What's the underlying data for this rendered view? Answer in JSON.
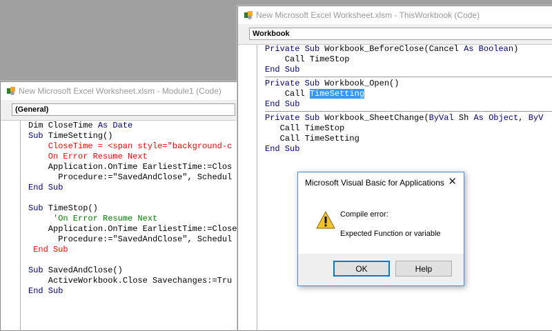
{
  "module_window": {
    "title": "New Microsoft Excel Worksheet.xlsm - Module1 (Code)",
    "object_combo": "(General)",
    "code": [
      {
        "segments": [
          {
            "t": "Dim CloseTime ",
            "c": ""
          },
          {
            "t": "As",
            "c": "kw"
          },
          {
            "t": " Date",
            "c": "kw"
          }
        ]
      },
      {
        "segments": [
          {
            "t": "Sub",
            "c": "kw"
          },
          {
            "t": " TimeSetting()",
            "c": ""
          }
        ]
      },
      {
        "segments": [
          {
            "t": "    CloseTime = <span style=\"background-c",
            "c": "err"
          }
        ]
      },
      {
        "segments": [
          {
            "t": "    On Error Resume Next",
            "c": "err"
          }
        ]
      },
      {
        "segments": [
          {
            "t": "    Application.OnTime EarliestTime:=Clos",
            "c": ""
          }
        ]
      },
      {
        "segments": [
          {
            "t": "      Procedure:=\"SavedAndClose\", Schedul",
            "c": ""
          }
        ]
      },
      {
        "segments": [
          {
            "t": "End Sub",
            "c": "kw"
          }
        ]
      },
      {
        "segments": [
          {
            "t": "",
            "c": ""
          }
        ]
      },
      {
        "segments": [
          {
            "t": "Sub",
            "c": "kw"
          },
          {
            "t": " TimeStop()",
            "c": ""
          }
        ]
      },
      {
        "segments": [
          {
            "t": "     'On Error Resume Next",
            "c": "cmt"
          }
        ]
      },
      {
        "segments": [
          {
            "t": "    Application.OnTime EarliestTime:=Close",
            "c": ""
          }
        ]
      },
      {
        "segments": [
          {
            "t": "      Procedure:=\"SavedAndClose\", Schedul",
            "c": ""
          }
        ]
      },
      {
        "segments": [
          {
            "t": " End Sub",
            "c": "err"
          }
        ]
      },
      {
        "segments": [
          {
            "t": "",
            "c": ""
          }
        ]
      },
      {
        "segments": [
          {
            "t": "Sub",
            "c": "kw"
          },
          {
            "t": " SavedAndClose()",
            "c": ""
          }
        ]
      },
      {
        "segments": [
          {
            "t": "    ActiveWorkbook.Close Savechanges:=Tru",
            "c": ""
          }
        ]
      },
      {
        "segments": [
          {
            "t": "End Sub",
            "c": "kw"
          }
        ]
      }
    ]
  },
  "workbook_window": {
    "title": "New Microsoft Excel Worksheet.xlsm - ThisWorkbook (Code)",
    "object_combo": "Workbook",
    "procedures": [
      [
        {
          "segments": [
            {
              "t": "Private Sub",
              "c": "kw"
            },
            {
              "t": " Workbook_BeforeClose(Cancel ",
              "c": ""
            },
            {
              "t": "As Boolean",
              "c": "kw"
            },
            {
              "t": ")",
              "c": ""
            }
          ]
        },
        {
          "segments": [
            {
              "t": "    Call TimeStop",
              "c": ""
            }
          ]
        },
        {
          "segments": [
            {
              "t": "End Sub",
              "c": "kw"
            }
          ]
        }
      ],
      [
        {
          "segments": [
            {
              "t": "Private Sub",
              "c": "kw"
            },
            {
              "t": " Workbook_Open()",
              "c": ""
            }
          ]
        },
        {
          "segments": [
            {
              "t": "    Call ",
              "c": ""
            },
            {
              "t": "TimeSetting",
              "c": "sel"
            }
          ]
        },
        {
          "segments": [
            {
              "t": "End Sub",
              "c": "kw"
            }
          ]
        }
      ],
      [
        {
          "segments": [
            {
              "t": "Private Sub",
              "c": "kw"
            },
            {
              "t": " Workbook_SheetChange(",
              "c": ""
            },
            {
              "t": "ByVal",
              "c": "kw"
            },
            {
              "t": " Sh ",
              "c": ""
            },
            {
              "t": "As Object",
              "c": "kw"
            },
            {
              "t": ", ",
              "c": ""
            },
            {
              "t": "ByV",
              "c": "kw"
            }
          ]
        },
        {
          "segments": [
            {
              "t": "   Call TimeStop",
              "c": ""
            }
          ]
        },
        {
          "segments": [
            {
              "t": "   Call TimeSetting",
              "c": ""
            }
          ]
        },
        {
          "segments": [
            {
              "t": "End Sub",
              "c": "kw"
            }
          ]
        }
      ]
    ]
  },
  "dialog": {
    "title": "Microsoft Visual Basic for Applications",
    "close_glyph": "✕",
    "message_title": "Compile error:",
    "message_body": "Expected Function or variable",
    "ok_label": "OK",
    "help_label": "Help",
    "icon": "warning-icon"
  },
  "colors": {
    "keyword": "#00007f",
    "error": "#ff0000",
    "comment": "#008000",
    "selection": "#3399ff"
  }
}
